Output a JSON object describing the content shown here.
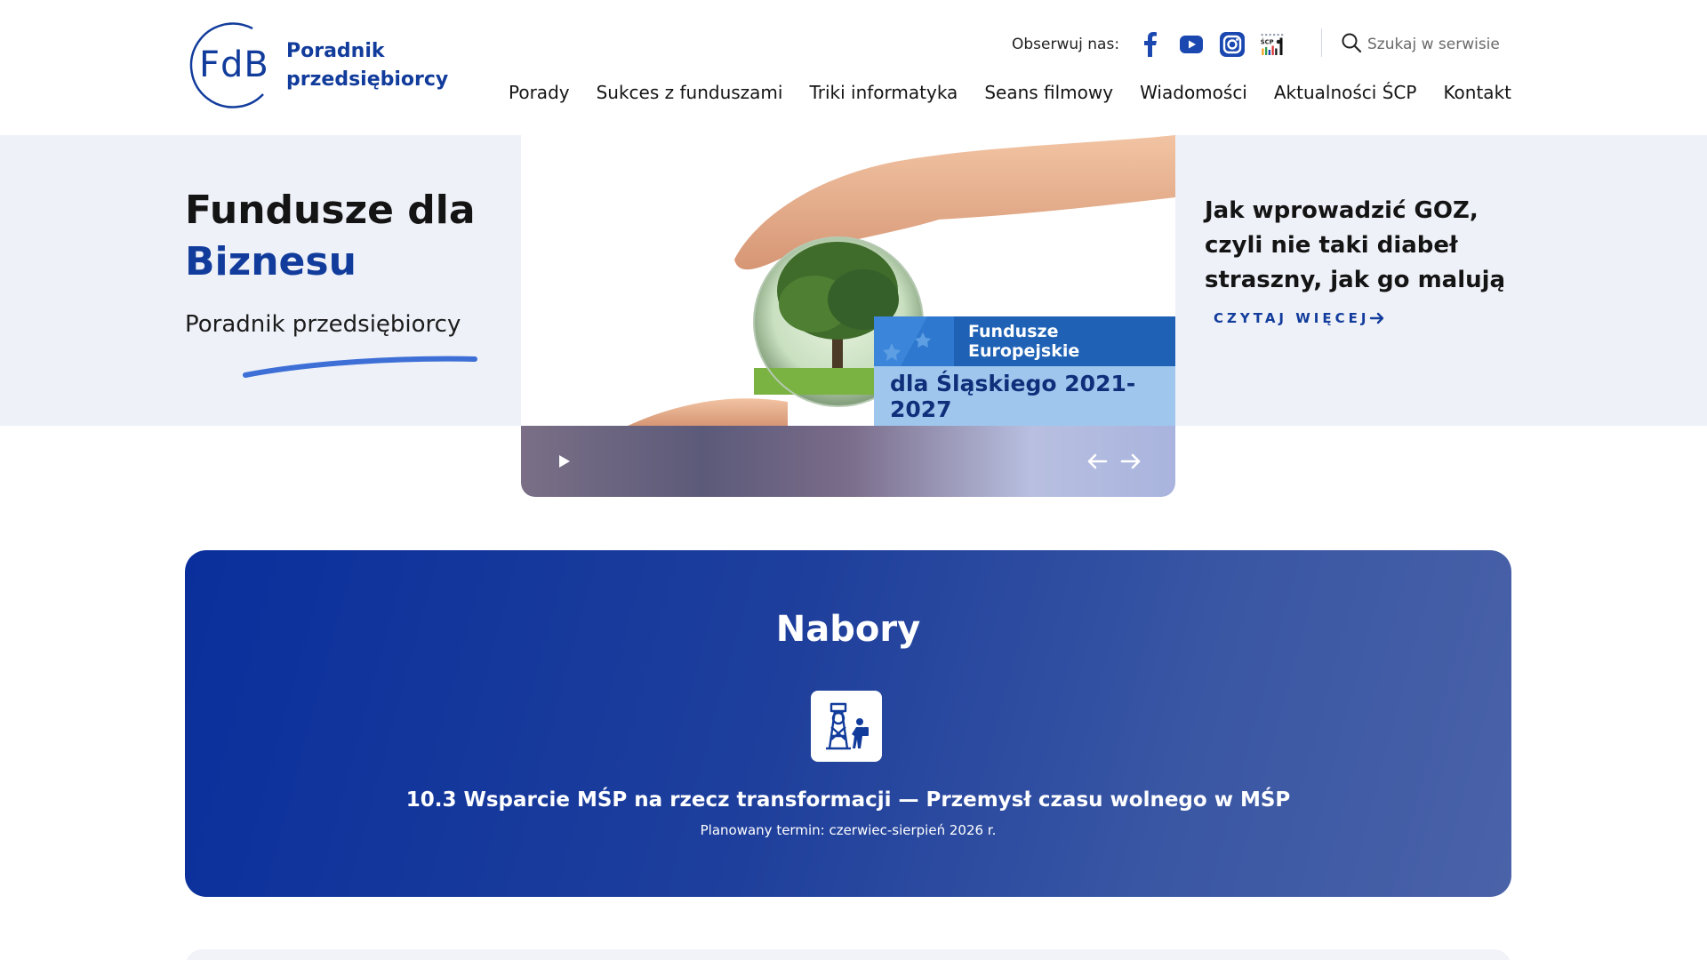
{
  "header": {
    "logo_abbr": "FdB",
    "logo_line1": "Poradnik",
    "logo_line2": "przedsiębiorcy",
    "follow_label": "Obserwuj nas:",
    "social": [
      "facebook-icon",
      "youtube-icon",
      "instagram-icon",
      "scp-icon"
    ],
    "scp_badge": "ŚCP",
    "search_placeholder": "Szukaj w serwisie",
    "nav": [
      "Porady",
      "Sukces z funduszami",
      "Triki informatyka",
      "Seans filmowy",
      "Wiadomości",
      "Aktualności ŚCP",
      "Kontakt"
    ]
  },
  "hero": {
    "title_line1": "Fundusze dla",
    "title_line2": "Biznesu",
    "subtitle": "Poradnik przedsiębiorcy",
    "slide_badge_top": "Fundusze Europejskie",
    "slide_badge_bottom": "dla Śląskiego 2021-2027",
    "article_title": "Jak wprowadzić GOZ, czyli nie taki diabeł straszny, jak go malują",
    "read_more": "CZYTAJ WIĘCEJ"
  },
  "nabory": {
    "heading": "Nabory",
    "item_title": "10.3 Wsparcie MŚP na rzecz transformacji — Przemysł czasu wolnego w MŚP",
    "item_date": "Planowany termin: czerwiec-sierpień 2026 r."
  },
  "colors": {
    "brand_blue": "#123c9c",
    "hero_bg": "#eef1f8",
    "badge_blue": "#1f62b5",
    "badge_light": "#9fc7ee"
  }
}
